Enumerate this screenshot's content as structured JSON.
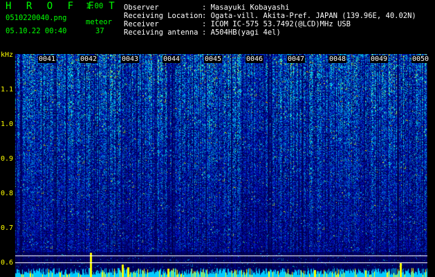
{
  "app": {
    "logo": "H R O F F T",
    "version": "1.00",
    "filename": "0510220040.png",
    "datetime": "05.10.22 00:40",
    "meteor_label": "meteor",
    "meteor_count": "37"
  },
  "info": {
    "observer_label": "Observer",
    "observer_value": ": Masayuki Kobayashi",
    "location_label": "Receiving Location",
    "location_value": ": Ogata-vill. Akita-Pref. JAPAN (139.96E, 40.02N)",
    "receiver_label": "Receiver",
    "receiver_value": ": ICOM IC-575 53.7492(@LCD)MHz USB",
    "antenna_label": "Receiving antenna",
    "antenna_value": ": A504HB(yagi 4el)"
  },
  "axis": {
    "unit": "kHz",
    "ticks": [
      "1.1",
      "1.0",
      "0.9",
      "0.8",
      "0.7",
      "0.6"
    ]
  },
  "time_labels": [
    "0041",
    "0042",
    "0043",
    "0044",
    "0045",
    "0046",
    "0047",
    "0048",
    "0049",
    "0050"
  ],
  "colors": {
    "accent_green": "#00ff00",
    "axis_yellow": "#ffff00",
    "header_white": "#ffffff",
    "spectrum_dark": "#0a1a6e",
    "spectrum_bright": "#00ffff"
  }
}
